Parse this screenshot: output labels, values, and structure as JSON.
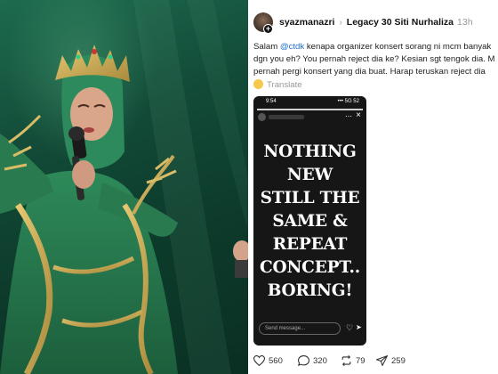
{
  "post": {
    "username": "syazmanazri",
    "community": "Legacy 30 Siti Nurhaliza",
    "timestamp": "13h",
    "text_lines": [
      "Salam ",
      "dgn you eh? You pernah reject dia ke? Kesian sgt tengok dia. M",
      "pernah pergi konsert yang dia buat. Harap teruskan reject dia"
    ],
    "mention": "@ctdk",
    "line1_rest": " kenapa organizer konsert sorang ni mcm banyak",
    "translate_label": "Translate"
  },
  "story": {
    "status_time": "9:54",
    "status_right": "••• 5G 52",
    "text_lines": [
      "NOTHING",
      "NEW",
      "STILL THE",
      "SAME &",
      "REPEAT",
      "CONCEPT..",
      "BORING!"
    ],
    "send_placeholder": "Send message..."
  },
  "actions": {
    "likes": "560",
    "comments": "320",
    "reposts": "79",
    "shares": "259"
  },
  "colors": {
    "mention": "#1f6fd1",
    "photo_bg": "#124a37",
    "story_bg": "#161616"
  }
}
